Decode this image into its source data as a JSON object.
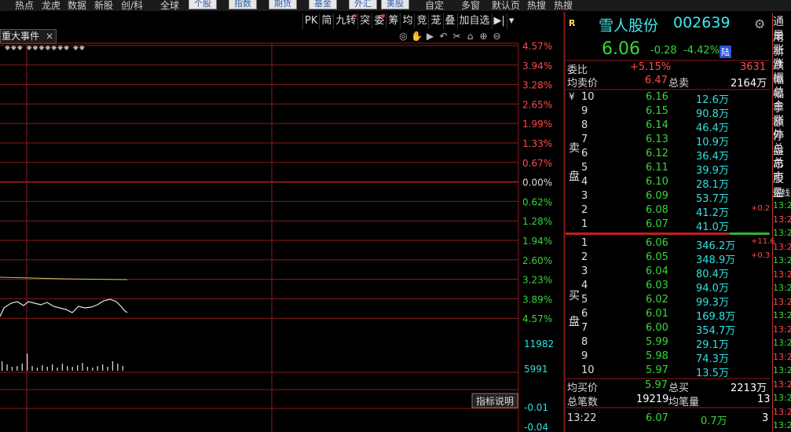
{
  "topmenu": {
    "plain": [
      "热点",
      "龙虎",
      "数据",
      "新股",
      "创/科",
      "全球"
    ],
    "buttons": [
      "个股",
      "指数",
      "期货",
      "基金",
      "外汇",
      "美股"
    ],
    "right": [
      "自定",
      "多窗",
      "默认页",
      "热搜",
      "热搜"
    ]
  },
  "chart_tools": [
    "PK",
    "简",
    "九转",
    "突",
    "委",
    "筹",
    "均",
    "竞",
    "茏",
    "叠",
    "加自选",
    "▶|",
    "▾"
  ],
  "event_tab": {
    "label": "重大事件",
    "close": "×"
  },
  "chart_controls": [
    "◎",
    "✋",
    "▶",
    "↶",
    "✂",
    "⌂",
    "⊕",
    "⊖"
  ],
  "diamonds": "◆◆◆ ◆◆◆◆◆◆◆ ◆◆",
  "pct_axis": {
    "up": [
      "4.57%",
      "3.94%",
      "3.28%",
      "2.65%",
      "1.99%",
      "1.33%",
      "0.67%"
    ],
    "zero": "0.00%",
    "down": [
      "0.62%",
      "1.28%",
      "1.94%",
      "2.60%",
      "3.23%",
      "3.89%",
      "4.57%"
    ],
    "vol": [
      "11982",
      "5991"
    ],
    "macd": [
      "-0.01",
      "-0.04"
    ]
  },
  "indicator_btn": "指标说明",
  "stock": {
    "icon": "R",
    "name": "雪人股份",
    "code": "002639",
    "price": "6.06",
    "change": "-0.28",
    "change_pct": "-4.42%",
    "market_badge": "陆"
  },
  "stats": {
    "weibi_label": "委比",
    "weibi_value": "+5.15%",
    "weicha_value": "3631",
    "avg_sell_label": "均卖价",
    "avg_sell_value": "6.47",
    "total_sell_label": "总卖",
    "total_sell_value": "2164万"
  },
  "sell_side": {
    "currency": "¥",
    "label1": "卖",
    "label2": "盘"
  },
  "sell_levels": [
    {
      "lvl": "10",
      "price": "6.16",
      "vol": "12.6万",
      "chg": ""
    },
    {
      "lvl": "9",
      "price": "6.15",
      "vol": "90.8万",
      "chg": ""
    },
    {
      "lvl": "8",
      "price": "6.14",
      "vol": "46.4万",
      "chg": ""
    },
    {
      "lvl": "7",
      "price": "6.13",
      "vol": "10.9万",
      "chg": ""
    },
    {
      "lvl": "6",
      "price": "6.12",
      "vol": "36.4万",
      "chg": ""
    },
    {
      "lvl": "5",
      "price": "6.11",
      "vol": "39.9万",
      "chg": ""
    },
    {
      "lvl": "4",
      "price": "6.10",
      "vol": "28.1万",
      "chg": ""
    },
    {
      "lvl": "3",
      "price": "6.09",
      "vol": "53.7万",
      "chg": ""
    },
    {
      "lvl": "2",
      "price": "6.08",
      "vol": "41.2万",
      "chg": "+0.2"
    },
    {
      "lvl": "1",
      "price": "6.07",
      "vol": "41.0万",
      "chg": ""
    }
  ],
  "buy_side": {
    "label1": "买",
    "label2": "盘"
  },
  "buy_levels": [
    {
      "lvl": "1",
      "price": "6.06",
      "vol": "346.2万",
      "chg": "+11.6"
    },
    {
      "lvl": "2",
      "price": "6.05",
      "vol": "348.9万",
      "chg": "+0.3"
    },
    {
      "lvl": "3",
      "price": "6.04",
      "vol": "80.4万",
      "chg": ""
    },
    {
      "lvl": "4",
      "price": "6.03",
      "vol": "94.0万",
      "chg": ""
    },
    {
      "lvl": "5",
      "price": "6.02",
      "vol": "99.3万",
      "chg": ""
    },
    {
      "lvl": "6",
      "price": "6.01",
      "vol": "169.8万",
      "chg": ""
    },
    {
      "lvl": "7",
      "price": "6.00",
      "vol": "354.7万",
      "chg": ""
    },
    {
      "lvl": "8",
      "price": "5.99",
      "vol": "29.1万",
      "chg": ""
    },
    {
      "lvl": "9",
      "price": "5.98",
      "vol": "74.3万",
      "chg": ""
    },
    {
      "lvl": "10",
      "price": "5.97",
      "vol": "13.5万",
      "chg": ""
    }
  ],
  "bottom_stats": {
    "avg_buy_label": "均买价",
    "avg_buy_value": "5.97",
    "total_buy_label": "总买",
    "total_buy_value": "2213万",
    "total_trades_label": "总笔数",
    "total_trades_value": "19219",
    "avg_vol_label": "均笔量",
    "avg_vol_value": "13"
  },
  "last_tick": {
    "time": "13:22",
    "price": "6.07",
    "vol": "0.7万",
    "count": "3"
  },
  "far_col": {
    "labels": [
      "通用",
      "最新",
      "涨跌",
      "涨幅",
      "振幅",
      "总手",
      "金额",
      "涨停",
      "外盘",
      "总市",
      "总股",
      "市盈",
      "短线"
    ],
    "times": [
      "13:2",
      "13:2",
      "13:2",
      "13:2",
      "13:2",
      "13:2",
      "13:2",
      "13:2",
      "13:2",
      "13:2",
      "13:2",
      "13:2",
      "13:2",
      "13:2",
      "13:2",
      "13:2",
      "13:2"
    ]
  },
  "colors": {
    "up": "#ff4a4a",
    "down": "#3ad53a",
    "volume": "#33e0e0",
    "grid": "#8b1a1a"
  }
}
